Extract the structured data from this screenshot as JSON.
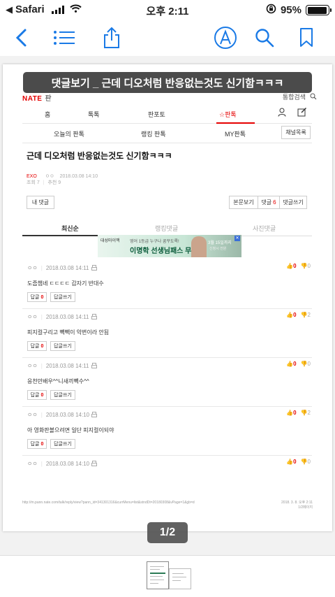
{
  "status_bar": {
    "back_app": "Safari",
    "time": "오후 2:11",
    "battery": "95%",
    "battery_level": 0.95
  },
  "toolbar": {
    "icons": [
      "back-chevron-icon",
      "list-icon",
      "share-icon",
      "markup-icon",
      "search-icon",
      "bookmark-icon"
    ]
  },
  "document": {
    "overlay_title": "댓글보기 _ 근데 디오처럼 반응없는것도 신기함ㅋㅋㅋ",
    "site_logo": "NATE",
    "site_logo_sub": "판",
    "login_text": "통합검색",
    "nav_primary": [
      "홈",
      "톡톡",
      "판포토",
      "☆판톡"
    ],
    "nav_secondary": [
      "오늘의 판톡",
      "랭킹 판톡",
      "MY판톡"
    ],
    "channel_button": "채널목록",
    "post": {
      "title": "근데 디오처럼 반응없는것도 신기함ㅋㅋㅋ",
      "author": "EXO",
      "nick": "ㅇㅇ",
      "date": "2018.03.08 14:10",
      "views": "조회 7",
      "recommend": "추천 9"
    },
    "my_comment_button": "내 댓글",
    "view_original_button": "본문보기",
    "comment_count_label": "댓글",
    "comment_count": "6",
    "write_comment_button": "댓글쓰기",
    "tabs": [
      "최신순",
      "랭킹댓글",
      "사진댓글"
    ],
    "ad": {
      "brand": "대성마이맥",
      "line1": "영어 1등급 누구나 꿈꾸도록!",
      "line2": "이명학 선생님패스 무료",
      "right1": "3월 15일까지",
      "right2": "신청시 전원"
    },
    "comments": [
      {
        "nick": "ㅇㅇ",
        "date": "2018.03.08 14:11",
        "text": "도줍챔녜 ㄷㄷㄷㄷ 갑자기 반대수",
        "reply_label": "답글",
        "reply_count": "0",
        "write_label": "답글쓰기",
        "up": "0",
        "down": "0"
      },
      {
        "nick": "ㅇㅇ",
        "date": "2018.03.08 14:11",
        "text": "피지컬구리고 빽빽이 악변이라 안됨",
        "reply_label": "답글",
        "reply_count": "0",
        "write_label": "답글쓰기",
        "up": "0",
        "down": "2"
      },
      {
        "nick": "ㅇㅇ",
        "date": "2018.03.08 14:11",
        "text": "응천만배우^^니새끼빽수^^",
        "reply_label": "답글",
        "reply_count": "0",
        "write_label": "답글쓰기",
        "up": "0",
        "down": "0"
      },
      {
        "nick": "ㅇㅇ",
        "date": "2018.03.08 14:10",
        "text": "아 영화판볼으려면 일단 피지컬이되야",
        "reply_label": "답글",
        "reply_count": "0",
        "write_label": "답글쓰기",
        "up": "0",
        "down": "2"
      },
      {
        "nick": "ㅇㅇ",
        "date": "2018.03.08 14:10",
        "text": "",
        "reply_label": "",
        "reply_count": "",
        "write_label": "",
        "up": "0",
        "down": "0"
      }
    ],
    "footer_url": "http://m.pann.nate.com/talk/reply/view?pann_id=341301316&currMenu=list&stndDt=20180308&vPage=1&gb=d",
    "footer_date": "2018. 3. 8. 오후 2:11",
    "footer_page": "1/2페이지"
  },
  "page_indicator": "1/2",
  "colors": {
    "accent": "#1a7ae6",
    "nate_red": "#e50000"
  }
}
